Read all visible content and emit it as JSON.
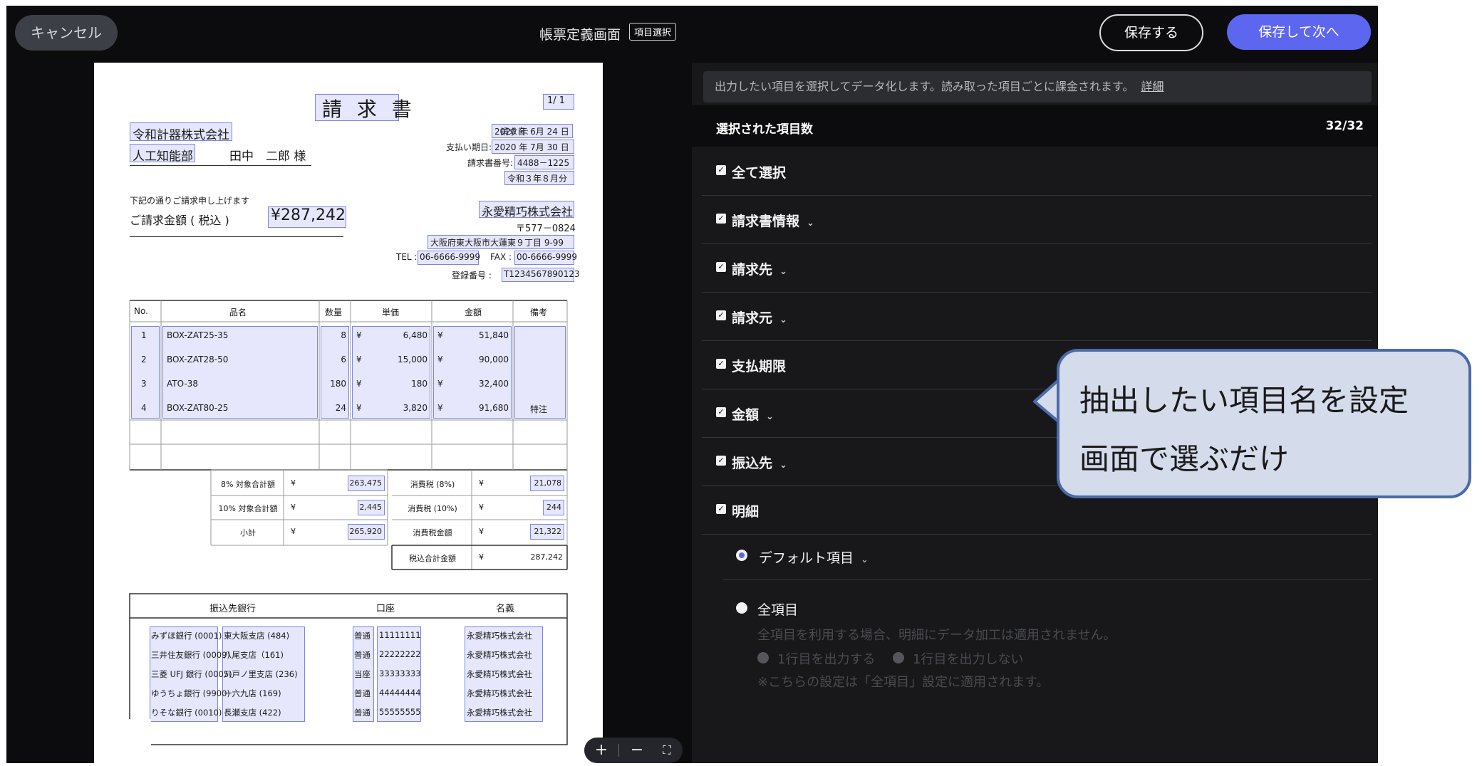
{
  "header": {
    "cancel_label": "キャンセル",
    "title": "帳票定義画面",
    "mode_badge": "項目選択",
    "save_label": "保存する",
    "save_next_label": "保存して次へ"
  },
  "invoice": {
    "title": "請 求 書",
    "page": "1/ 1",
    "recipient_company": "令和計器株式会社",
    "recipient_dept": "人工知能部",
    "recipient_person": "田中　二郎 様",
    "meta_labels": [
      "請求日:",
      "支払い期日:",
      "請求書番号:"
    ],
    "meta_values": [
      "2020 年 6月 24 日",
      "2020 年 7月 30 日",
      "4488－1225",
      "令和３年８月分"
    ],
    "intro": "下記の通りご請求申し上げます",
    "amount_label": "ご請求金額 ( 税込 )",
    "amount_value": "¥287,242",
    "issuer_company": "永愛精巧株式会社",
    "issuer_postal": "〒577－0824",
    "issuer_address": "大阪府東大阪市大蓮東９丁目 9-99",
    "tel_label": "TEL :",
    "tel_value": "06-6666-9999",
    "fax_label": "FAX :",
    "fax_value": "00-6666-9999",
    "reg_label": "登録番号 :",
    "reg_value": "T1234567890123",
    "table_headers": [
      "No.",
      "品名",
      "数量",
      "単価",
      "金額",
      "備考"
    ],
    "currency": "¥",
    "rows": [
      {
        "no": "1",
        "name": "BOX-ZAT25-35",
        "qty": "8",
        "price": "6,480",
        "amount": "51,840",
        "note": ""
      },
      {
        "no": "2",
        "name": "BOX-ZAT28-50",
        "qty": "6",
        "price": "15,000",
        "amount": "90,000",
        "note": ""
      },
      {
        "no": "3",
        "name": "ATO-38",
        "qty": "180",
        "price": "180",
        "amount": "32,400",
        "note": ""
      },
      {
        "no": "4",
        "name": "BOX-ZAT80-25",
        "qty": "24",
        "price": "3,820",
        "amount": "91,680",
        "note": "特注"
      }
    ],
    "totals_left": [
      {
        "label": "8% 対象合計額",
        "value": "263,475"
      },
      {
        "label": "10% 対象合計額",
        "value": "2,445"
      },
      {
        "label": "小計",
        "value": "265,920"
      }
    ],
    "totals_right": [
      {
        "label": "消費税 (8%)",
        "value": "21,078"
      },
      {
        "label": "消費税 (10%)",
        "value": "244"
      },
      {
        "label": "消費税金額",
        "value": "21,322"
      },
      {
        "label": "税込合計金額",
        "value": "287,242"
      }
    ],
    "bank_headers": [
      "振込先銀行",
      "口座",
      "名義"
    ],
    "banks": [
      {
        "bank": "みずほ銀行 (0001)",
        "branch": "東大阪支店 (484)",
        "type": "普通",
        "acct": "11111111",
        "holder": "永愛精巧株式会社"
      },
      {
        "bank": "三井住友銀行 (0009)",
        "branch": "八尾支店（161)",
        "type": "普通",
        "acct": "22222222",
        "holder": "永愛精巧株式会社"
      },
      {
        "bank": "三菱 UFJ 銀行 (0005)",
        "branch": "八戸ノ里支店 (236)",
        "type": "当座",
        "acct": "33333333",
        "holder": "永愛精巧株式会社"
      },
      {
        "bank": "ゆうちょ銀行 (9900)",
        "branch": "一六九店 (169)",
        "type": "普通",
        "acct": "44444444",
        "holder": "永愛精巧株式会社"
      },
      {
        "bank": "りそな銀行 (0010)",
        "branch": "長瀬支店 (422)",
        "type": "普通",
        "acct": "55555555",
        "holder": "永愛精巧株式会社"
      }
    ]
  },
  "zoom": {
    "plus": "+",
    "minus": "−",
    "fit": "⛶"
  },
  "panel": {
    "info": "出力したい項目を選択してデータ化します。読み取った項目ごとに課金されます。",
    "info_link": "詳細",
    "count_label": "選択された項目数",
    "count_value": "32/32",
    "items": [
      {
        "label": "全て選択",
        "chevron": ""
      },
      {
        "label": "請求書情報",
        "chevron": "⌄"
      },
      {
        "label": "請求先",
        "chevron": "⌄"
      },
      {
        "label": "請求元",
        "chevron": "⌄"
      },
      {
        "label": "支払期限",
        "chevron": ""
      },
      {
        "label": "金額",
        "chevron": "⌄"
      },
      {
        "label": "振込先",
        "chevron": "⌄"
      },
      {
        "label": "明細",
        "chevron": ""
      }
    ],
    "default_option": "デフォルト項目",
    "default_chevron": "⌄",
    "all_option": "全項目",
    "all_note": "全項目を利用する場合、明細にデータ加工は適用されません。",
    "output_first": "1行目を出力する",
    "no_output_first": "1行目を出力しない",
    "all_footnote": "※こちらの設定は「全項目」設定に適用されます。"
  },
  "callout": {
    "line1": "抽出したい項目名を設定",
    "line2": "画面で選ぶだけ"
  },
  "colors": {
    "accent": "#5d66ef",
    "highlight": "#7e84e8",
    "callout_fill": "#d4dcec",
    "callout_border": "#4a6aa8"
  }
}
